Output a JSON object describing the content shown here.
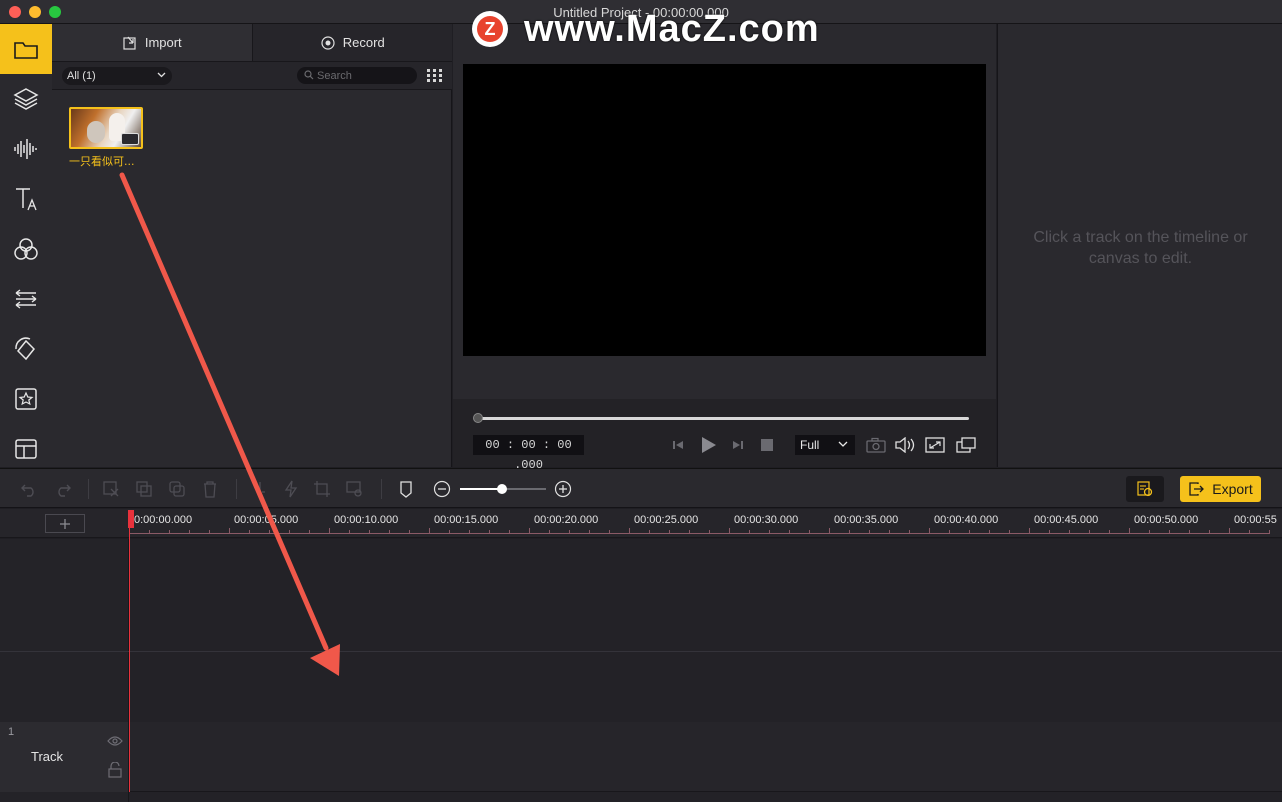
{
  "window": {
    "title": "Untitled Project - 00:00:00.000"
  },
  "watermark": {
    "logo_letter": "Z",
    "text": "www.MacZ.com"
  },
  "media_panel": {
    "tabs": [
      {
        "label": "Import",
        "icon": "import-icon"
      },
      {
        "label": "Record",
        "icon": "record-icon"
      }
    ],
    "filter_value": "All (1)",
    "search_placeholder": "Search",
    "items": [
      {
        "label": "一只看似可..."
      }
    ]
  },
  "preview": {
    "timecode": "00 : 00 : 00 .000",
    "quality": "Full"
  },
  "inspector": {
    "message": "Click a track on the timeline or canvas to edit."
  },
  "toolbar": {
    "export_label": "Export"
  },
  "ruler": {
    "labels": [
      "0:00:00.000",
      "00:00:05.000",
      "00:00:10.000",
      "00:00:15.000",
      "00:00:20.000",
      "00:00:25.000",
      "00:00:30.000",
      "00:00:35.000",
      "00:00:40.000",
      "00:00:45.000",
      "00:00:50.000",
      "00:00:55"
    ]
  },
  "tracks": [
    {
      "number": "1",
      "name": "Track"
    }
  ],
  "colors": {
    "accent": "#f5c11b",
    "playhead": "#e8323c",
    "annotation_arrow": "#f0584a"
  }
}
